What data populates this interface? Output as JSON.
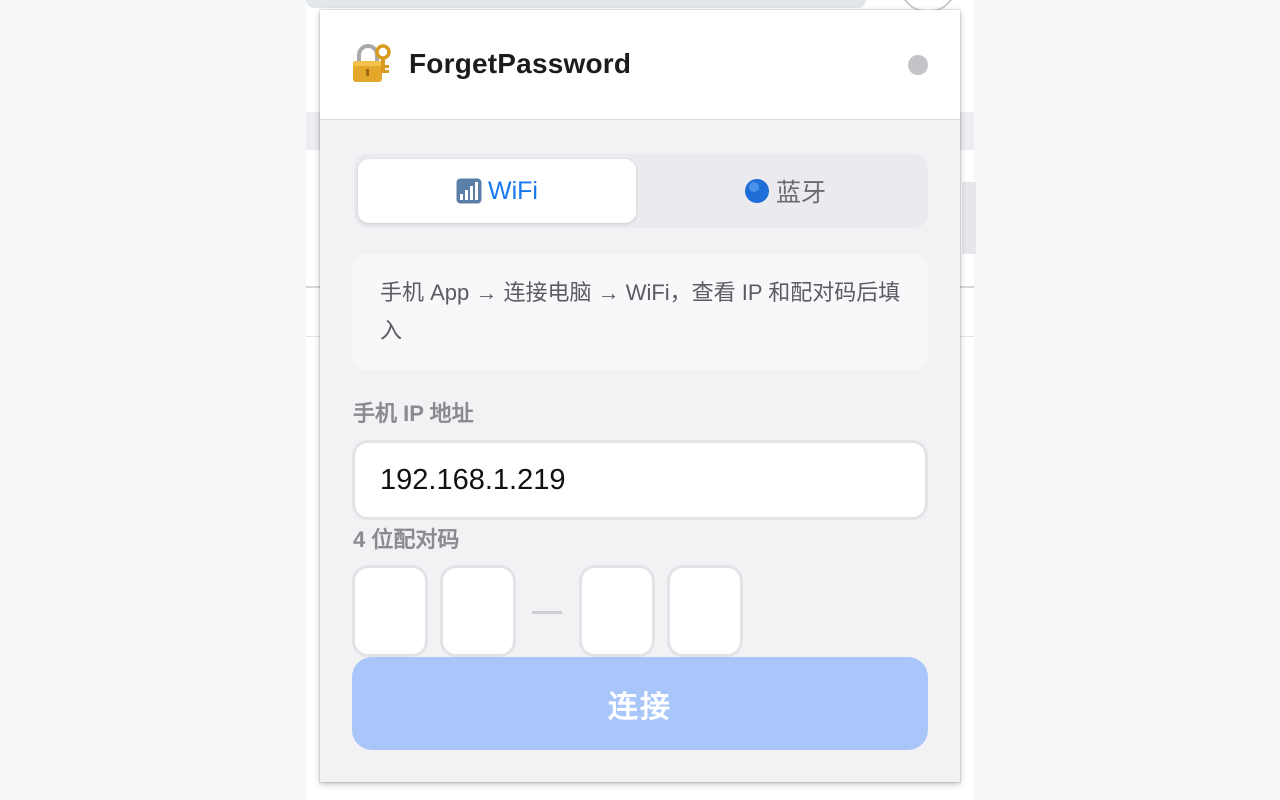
{
  "app": {
    "title": "ForgetPassword"
  },
  "tabs": {
    "wifi_label": "WiFi",
    "bluetooth_label": "蓝牙",
    "active": "wifi"
  },
  "info": {
    "text": "手机 App → 连接电脑 → WiFi，查看 IP 和配对码后填入"
  },
  "form": {
    "ip_label": "手机 IP 地址",
    "ip_value": "192.168.1.219",
    "code_label": "4 位配对码",
    "code_digits": [
      "",
      "",
      "",
      ""
    ]
  },
  "actions": {
    "connect_label": "连接"
  },
  "colors": {
    "accent": "#1877f2",
    "button_disabled": "#a8c6fa",
    "status_dot": "#c4c4c8",
    "panel_bg": "#f2f2f5"
  },
  "icons": {
    "header": "lock-with-key-icon",
    "wifi_tab": "signal-bars-icon",
    "bluetooth_tab": "blue-circle-icon",
    "status": "status-dot"
  }
}
